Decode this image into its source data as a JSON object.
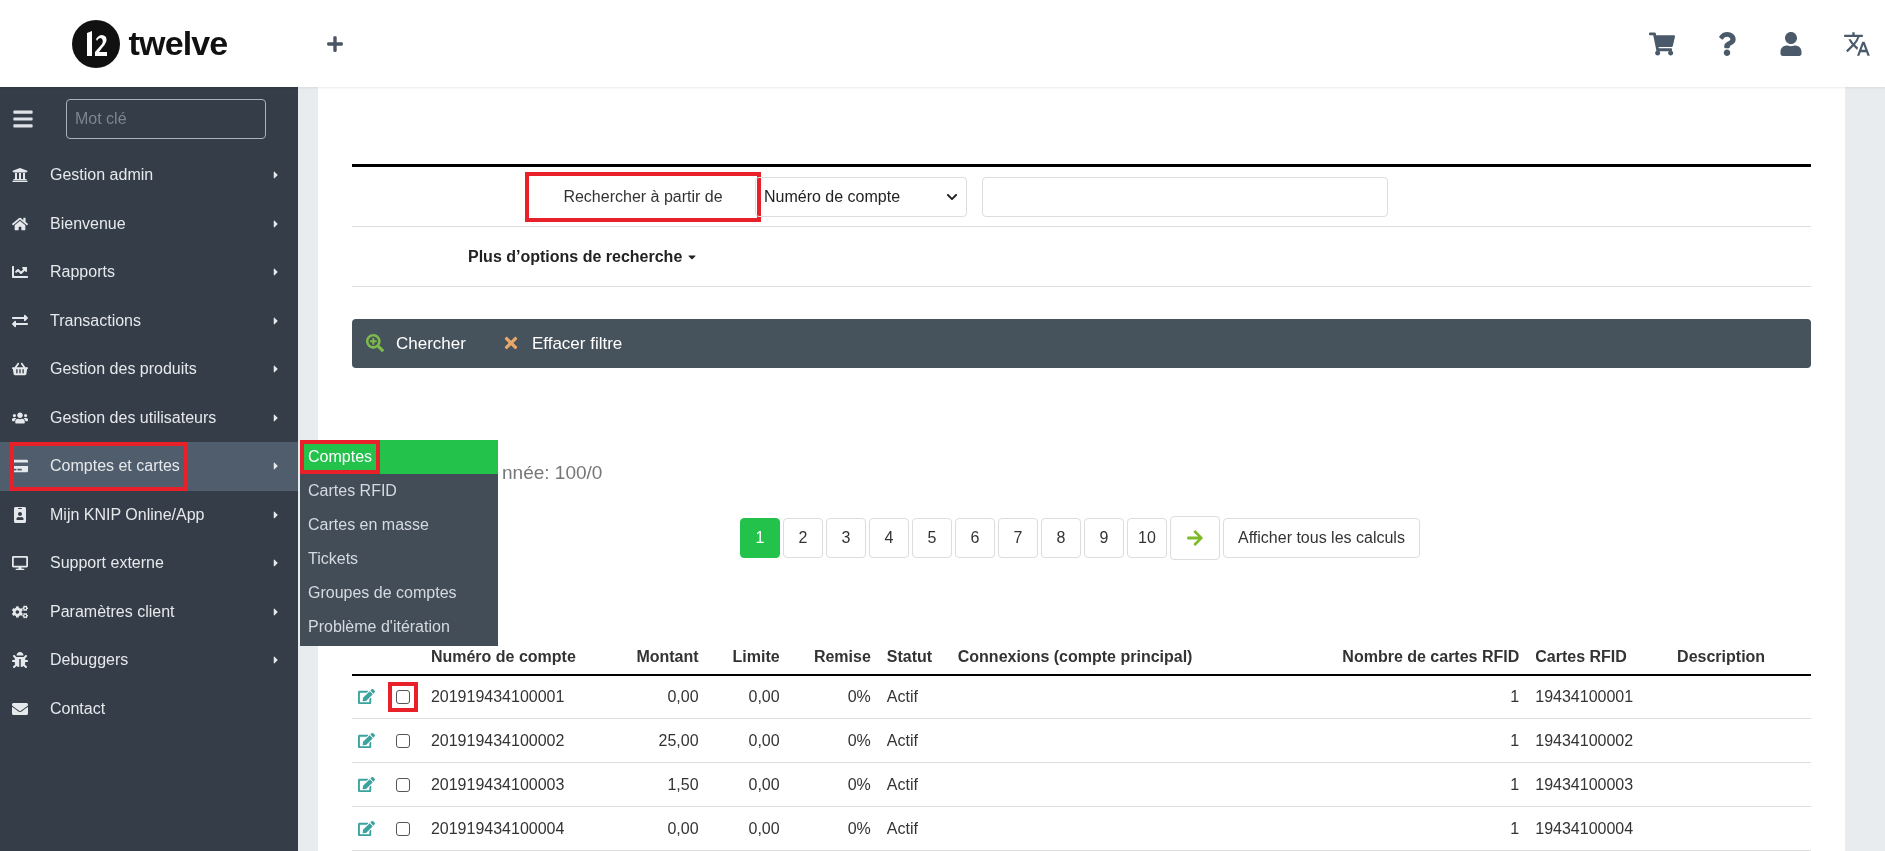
{
  "header": {
    "logo_text": "twelve"
  },
  "sidebar": {
    "search": {
      "placeholder": "Mot clé"
    },
    "items": [
      {
        "label": "Gestion admin",
        "selected": false,
        "highlighted": false
      },
      {
        "label": "Bienvenue",
        "selected": false,
        "highlighted": false
      },
      {
        "label": "Rapports",
        "selected": false,
        "highlighted": false
      },
      {
        "label": "Transactions",
        "selected": false,
        "highlighted": false
      },
      {
        "label": "Gestion des produits",
        "selected": false,
        "highlighted": false
      },
      {
        "label": "Gestion des utilisateurs",
        "selected": false,
        "highlighted": false
      },
      {
        "label": "Comptes et cartes",
        "selected": true,
        "highlighted": true
      },
      {
        "label": "Mijn KNIP Online/App",
        "selected": false,
        "highlighted": false
      },
      {
        "label": "Support externe",
        "selected": false,
        "highlighted": false
      },
      {
        "label": "Paramètres client",
        "selected": false,
        "highlighted": false
      },
      {
        "label": "Debuggers",
        "selected": false,
        "highlighted": false
      },
      {
        "label": "Contact",
        "selected": false,
        "highlighted": false
      }
    ]
  },
  "submenu": [
    {
      "label": "Comptes",
      "selected": true,
      "highlighted": true
    },
    {
      "label": "Cartes RFID",
      "selected": false,
      "highlighted": false
    },
    {
      "label": "Cartes en masse",
      "selected": false,
      "highlighted": false
    },
    {
      "label": "Tickets",
      "selected": false,
      "highlighted": false
    },
    {
      "label": "Groupes de comptes",
      "selected": false,
      "highlighted": false
    },
    {
      "label": "Problème d'itération",
      "selected": false,
      "highlighted": false
    }
  ],
  "search": {
    "label": "Rechercher à partir de",
    "label_highlighted": true,
    "select_value": "Numéro de compte",
    "more_options": "Plus d’options de recherche"
  },
  "actions": [
    "Chercher",
    "Effacer filtre"
  ],
  "summary": "nnée: 100/0",
  "pagination": {
    "pages": [
      {
        "label": "1",
        "selected": true
      },
      {
        "label": "2",
        "selected": false
      },
      {
        "label": "3",
        "selected": false
      },
      {
        "label": "4",
        "selected": false
      },
      {
        "label": "5",
        "selected": false
      },
      {
        "label": "6",
        "selected": false
      },
      {
        "label": "7",
        "selected": false
      },
      {
        "label": "8",
        "selected": false
      },
      {
        "label": "9",
        "selected": false
      },
      {
        "label": "10",
        "selected": false
      }
    ],
    "show_all": "Afficher tous les calculs"
  },
  "table": {
    "columns": [
      "Numéro de compte",
      "Montant",
      "Limite",
      "Remise",
      "Statut",
      "Connexions (compte principal)",
      "Nombre de cartes RFID",
      "Cartes RFID",
      "Description"
    ],
    "rows": [
      {
        "checked": false,
        "highlighted": true,
        "cells": [
          "201919434100001",
          "0,00",
          "0,00",
          "0%",
          "Actif",
          "",
          "1",
          "19434100001",
          ""
        ]
      },
      {
        "checked": false,
        "highlighted": false,
        "cells": [
          "201919434100002",
          "25,00",
          "0,00",
          "0%",
          "Actif",
          "",
          "1",
          "19434100002",
          ""
        ]
      },
      {
        "checked": false,
        "highlighted": false,
        "cells": [
          "201919434100003",
          "1,50",
          "0,00",
          "0%",
          "Actif",
          "",
          "1",
          "19434100003",
          ""
        ]
      },
      {
        "checked": false,
        "highlighted": false,
        "cells": [
          "201919434100004",
          "0,00",
          "0,00",
          "0%",
          "Actif",
          "",
          "1",
          "19434100004",
          ""
        ]
      }
    ]
  }
}
